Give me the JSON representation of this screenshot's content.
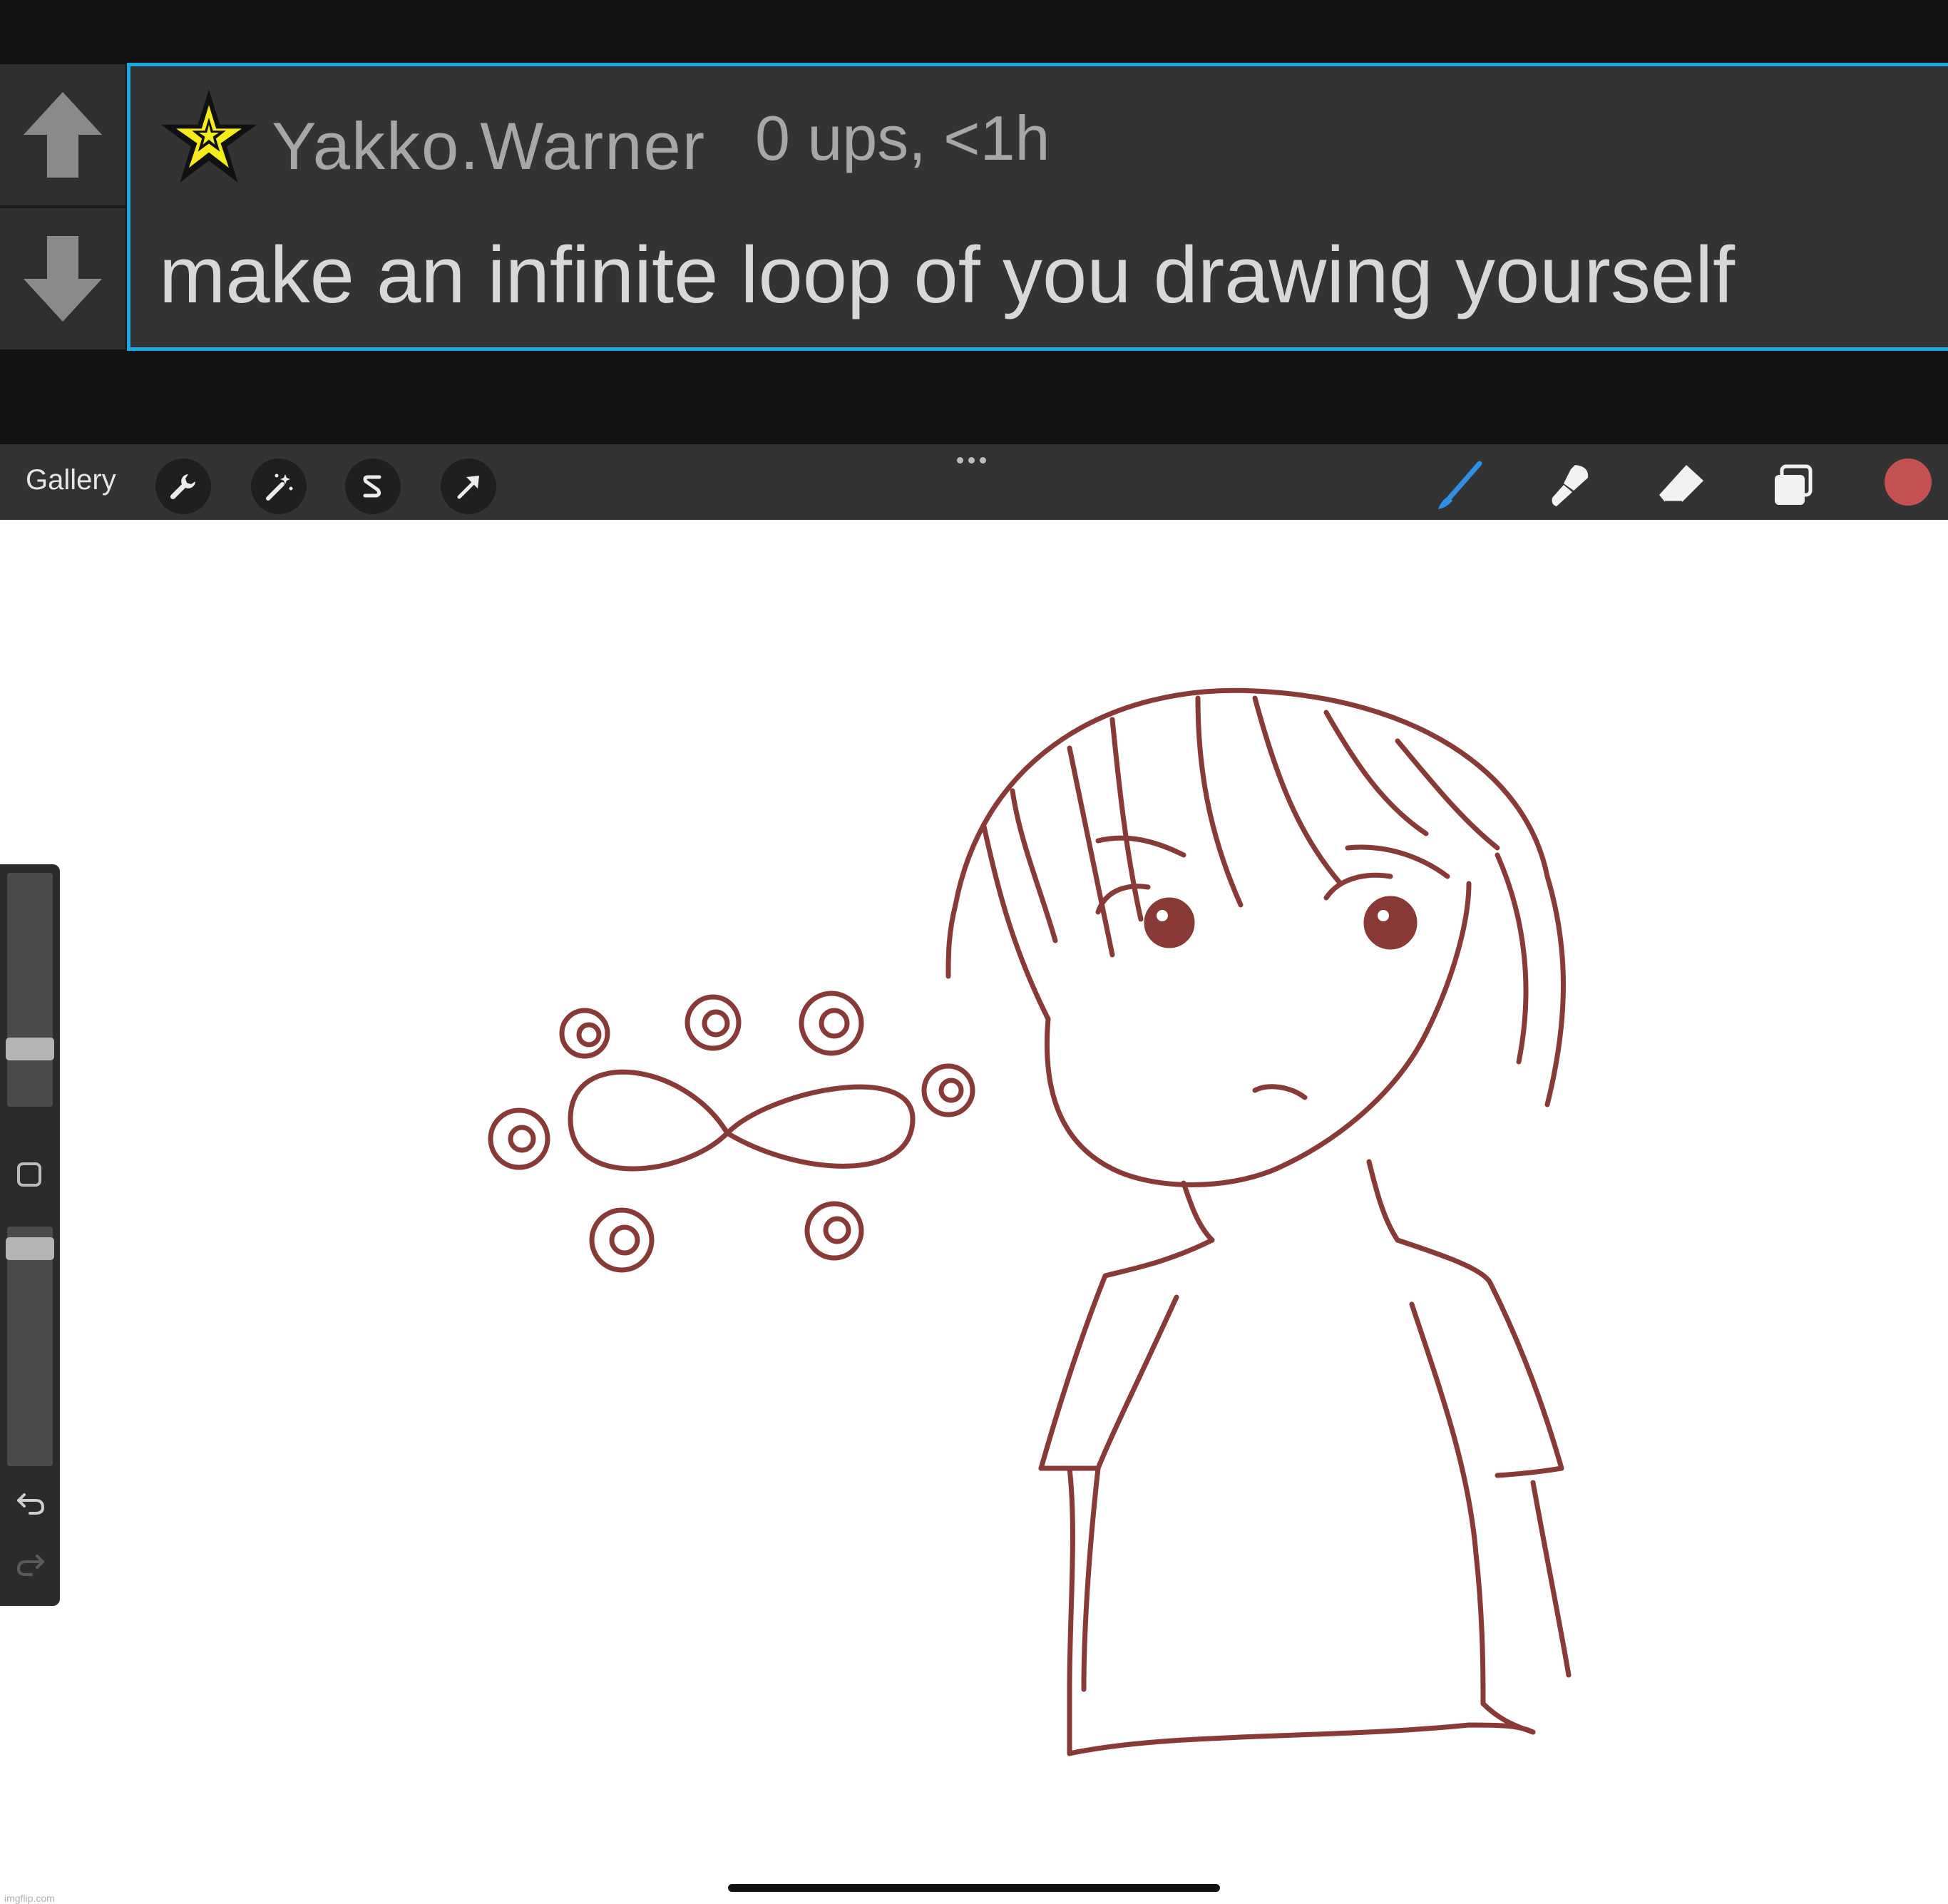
{
  "comment": {
    "username": "Yakko.Warner",
    "meta": "0 ups, <1h",
    "text": "make an infinite loop of you drawing yourself",
    "border_color": "#1aa9e0"
  },
  "vote": {
    "up_icon": "arrow-up-icon",
    "down_icon": "arrow-down-icon"
  },
  "toolbar": {
    "gallery_label": "Gallery",
    "left_tools": [
      "wrench-icon",
      "magic-wand-icon",
      "selection-s-icon",
      "transform-arrow-icon"
    ],
    "right_tools": [
      "brush-icon",
      "smudge-icon",
      "eraser-icon",
      "layers-icon"
    ],
    "active_tool": "brush-icon",
    "current_color": "#c55252",
    "accent": "#2e8fe6"
  },
  "canvas": {
    "stroke_color": "#8a3a36",
    "background": "#ffffff"
  },
  "sidebar": {
    "brush_size_level": 0.22,
    "opacity_level": 0.95,
    "modifier_icon": "square-modifier-icon",
    "undo_icon": "undo-icon",
    "redo_icon": "redo-icon"
  },
  "watermark": "imgflip.com"
}
